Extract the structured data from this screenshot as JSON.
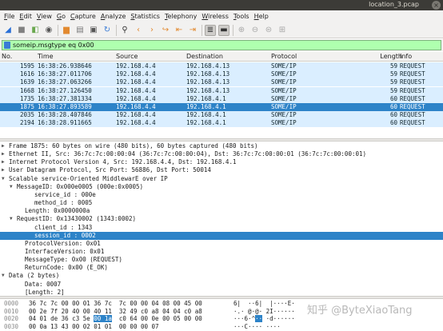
{
  "window": {
    "title": "location_3.pcap",
    "close_symbol": "×"
  },
  "menu": [
    "File",
    "Edit",
    "View",
    "Go",
    "Capture",
    "Analyze",
    "Statistics",
    "Telephony",
    "Wireless",
    "Tools",
    "Help"
  ],
  "toolbar_icons": [
    {
      "name": "shark-fin-start-icon",
      "glyph": "◢",
      "color": "#2a6fd6"
    },
    {
      "name": "stop-capture-icon",
      "glyph": "■",
      "color": "#808080"
    },
    {
      "name": "restart-capture-icon",
      "glyph": "◧",
      "color": "#6aa84f"
    },
    {
      "name": "capture-options-icon",
      "glyph": "◉",
      "color": "#555555"
    },
    {
      "name": "open-file-icon",
      "glyph": "▆",
      "color": "#e2892f"
    },
    {
      "name": "save-file-icon",
      "glyph": "▤",
      "color": "#777777"
    },
    {
      "name": "close-file-icon",
      "glyph": "▣",
      "color": "#555555"
    },
    {
      "name": "reload-file-icon",
      "glyph": "↻",
      "color": "#3a7bd5"
    },
    {
      "name": "find-packet-icon",
      "glyph": "⚲",
      "color": "#333333"
    },
    {
      "name": "go-back-icon",
      "glyph": "‹",
      "color": "#e2892f"
    },
    {
      "name": "go-forward-icon",
      "glyph": "›",
      "color": "#e2892f"
    },
    {
      "name": "go-to-packet-icon",
      "glyph": "↪",
      "color": "#e2892f"
    },
    {
      "name": "first-packet-icon",
      "glyph": "⇤",
      "color": "#e2892f"
    },
    {
      "name": "last-packet-icon",
      "glyph": "⇥",
      "color": "#e2892f"
    },
    {
      "name": "auto-scroll-icon",
      "glyph": "≣",
      "color": "#333333"
    },
    {
      "name": "colorize-icon",
      "glyph": "▬",
      "color": "#333333"
    },
    {
      "name": "zoom-in-icon",
      "glyph": "⊕",
      "color": "#a8a8a8"
    },
    {
      "name": "zoom-out-icon",
      "glyph": "⊖",
      "color": "#a8a8a8"
    },
    {
      "name": "zoom-reset-icon",
      "glyph": "⊜",
      "color": "#a8a8a8"
    },
    {
      "name": "resize-columns-icon",
      "glyph": "⊞",
      "color": "#a8a8a8"
    }
  ],
  "filter": {
    "value": "someip.msgtype eq 0x00"
  },
  "packet_list": {
    "columns": [
      "No.",
      "Time",
      "Source",
      "Destination",
      "Protocol",
      "Length",
      "Info"
    ],
    "rows": [
      {
        "no": "1595",
        "time": "16:38:26.938646",
        "src": "192.168.4.4",
        "dst": "192.168.4.13",
        "proto": "SOME/IP",
        "len": "59",
        "info": "REQUEST",
        "selected": false
      },
      {
        "no": "1616",
        "time": "16:38:27.011706",
        "src": "192.168.4.4",
        "dst": "192.168.4.13",
        "proto": "SOME/IP",
        "len": "59",
        "info": "REQUEST",
        "selected": false
      },
      {
        "no": "1639",
        "time": "16:38:27.063266",
        "src": "192.168.4.4",
        "dst": "192.168.4.13",
        "proto": "SOME/IP",
        "len": "59",
        "info": "REQUEST",
        "selected": false
      },
      {
        "no": "1668",
        "time": "16:38:27.126450",
        "src": "192.168.4.4",
        "dst": "192.168.4.13",
        "proto": "SOME/IP",
        "len": "59",
        "info": "REQUEST",
        "selected": false
      },
      {
        "no": "1735",
        "time": "16:38:27.381334",
        "src": "192.168.4.4",
        "dst": "192.168.4.1",
        "proto": "SOME/IP",
        "len": "60",
        "info": "REQUEST",
        "selected": false
      },
      {
        "no": "1875",
        "time": "16:38:27.893589",
        "src": "192.168.4.4",
        "dst": "192.168.4.1",
        "proto": "SOME/IP",
        "len": "60",
        "info": "REQUEST",
        "selected": true
      },
      {
        "no": "2035",
        "time": "16:38:28.407846",
        "src": "192.168.4.4",
        "dst": "192.168.4.1",
        "proto": "SOME/IP",
        "len": "60",
        "info": "REQUEST",
        "selected": false
      },
      {
        "no": "2194",
        "time": "16:38:28.911665",
        "src": "192.168.4.4",
        "dst": "192.168.4.1",
        "proto": "SOME/IP",
        "len": "60",
        "info": "REQUEST",
        "selected": false
      }
    ]
  },
  "details": [
    {
      "text": "Frame 1875: 60 bytes on wire (480 bits), 60 bytes captured (480 bits)",
      "level": 0,
      "twisty": "closed",
      "selected": false
    },
    {
      "text": "Ethernet II, Src: 36:7c:7c:00:00:04 (36:7c:7c:00:00:04), Dst: 36:7c:7c:00:00:01 (36:7c:7c:00:00:01)",
      "level": 0,
      "twisty": "closed",
      "selected": false
    },
    {
      "text": "Internet Protocol Version 4, Src: 192.168.4.4, Dst: 192.168.4.1",
      "level": 0,
      "twisty": "closed",
      "selected": false
    },
    {
      "text": "User Datagram Protocol, Src Port: 56886, Dst Port: 50014",
      "level": 0,
      "twisty": "closed",
      "selected": false
    },
    {
      "text": "Scalable service-Oriented MiddlewarE over IP",
      "level": 0,
      "twisty": "open",
      "selected": false
    },
    {
      "text": "MessageID: 0x000e0005 (000e:0x0005)",
      "level": 1,
      "twisty": "open",
      "selected": false
    },
    {
      "text": "service_id : 000e",
      "level": 3,
      "twisty": "none",
      "selected": false
    },
    {
      "text": "method_id : 0005",
      "level": 3,
      "twisty": "none",
      "selected": false
    },
    {
      "text": "Length: 0x0000000a",
      "level": 2,
      "twisty": "none",
      "selected": false
    },
    {
      "text": "RequestID: 0x13430002 (1343:0002)",
      "level": 1,
      "twisty": "open",
      "selected": false
    },
    {
      "text": "client_id : 1343",
      "level": 3,
      "twisty": "none",
      "selected": false
    },
    {
      "text": "session_id : 0002",
      "level": 3,
      "twisty": "none",
      "selected": true
    },
    {
      "text": "ProtocolVersion: 0x01",
      "level": 2,
      "twisty": "none",
      "selected": false
    },
    {
      "text": "InterfaceVersion: 0x01",
      "level": 2,
      "twisty": "none",
      "selected": false
    },
    {
      "text": "MessageType: 0x00 (REQUEST)",
      "level": 2,
      "twisty": "none",
      "selected": false
    },
    {
      "text": "ReturnCode: 0x00 (E_OK)",
      "level": 2,
      "twisty": "none",
      "selected": false
    },
    {
      "text": "Data (2 bytes)",
      "level": 0,
      "twisty": "open",
      "selected": false
    },
    {
      "text": "Data: 0007",
      "level": 2,
      "twisty": "none",
      "selected": false
    },
    {
      "text": "[Length: 2]",
      "level": 2,
      "twisty": "none",
      "selected": false
    }
  ],
  "bytes": [
    {
      "offset": "0000",
      "hex_pre": "36 7c 7c 00 00 01 36 7c  7c 00 00 04 08 00 45 00",
      "hex_hl": "",
      "hex_post": "",
      "ascii_pre": "6|  ··6|  |····E·",
      "ascii_hl": "",
      "ascii_post": ""
    },
    {
      "offset": "0010",
      "hex_pre": "00 2e 7f 20 40 00 40 11  32 49 c0 a8 04 04 c0 a8",
      "hex_hl": "",
      "hex_post": "",
      "ascii_pre": "·.· @·@· 2I······",
      "ascii_hl": "",
      "ascii_post": ""
    },
    {
      "offset": "0020",
      "hex_pre": "04 01 de 36 c3 5e ",
      "hex_hl": "00 1a",
      "hex_post": "  c0 64 00 0e 00 05 00 00",
      "ascii_pre": "···6·^",
      "ascii_hl": "··",
      "ascii_post": " ·d······"
    },
    {
      "offset": "0030",
      "hex_pre": "00 0a 13 43 00 02 01 01  00 00 00 07",
      "hex_hl": "",
      "hex_post": "",
      "ascii_pre": "···C···· ····",
      "ascii_hl": "",
      "ascii_post": ""
    }
  ],
  "watermark": "知乎 @ByteXiaoTang"
}
